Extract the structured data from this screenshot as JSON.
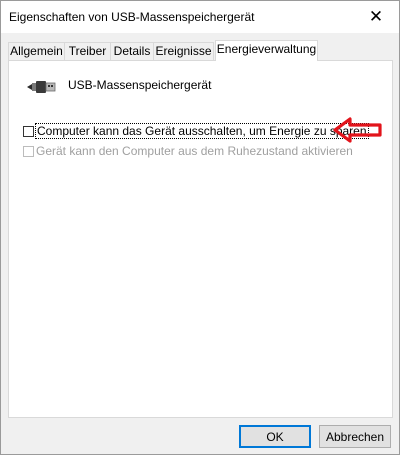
{
  "window": {
    "title": "Eigenschaften von USB-Massenspeichergerät",
    "close_glyph": "✕"
  },
  "tabs": [
    {
      "label": "Allgemein",
      "active": false
    },
    {
      "label": "Treiber",
      "active": false
    },
    {
      "label": "Details",
      "active": false
    },
    {
      "label": "Ereignisse",
      "active": false
    },
    {
      "label": "Energieverwaltung",
      "active": true
    }
  ],
  "device": {
    "icon": "usb-plug-icon",
    "name": "USB-Massenspeichergerät"
  },
  "options": [
    {
      "label": "Computer kann das Gerät ausschalten, um Energie zu sparen",
      "checked": false,
      "enabled": true,
      "focused": true
    },
    {
      "label": "Gerät kann den Computer aus dem Ruhezustand aktivieren",
      "checked": false,
      "enabled": false,
      "focused": false
    }
  ],
  "annotation": {
    "icon": "red-arrow-icon",
    "color": "#e2141b"
  },
  "buttons": {
    "ok": "OK",
    "cancel": "Abbrechen"
  }
}
